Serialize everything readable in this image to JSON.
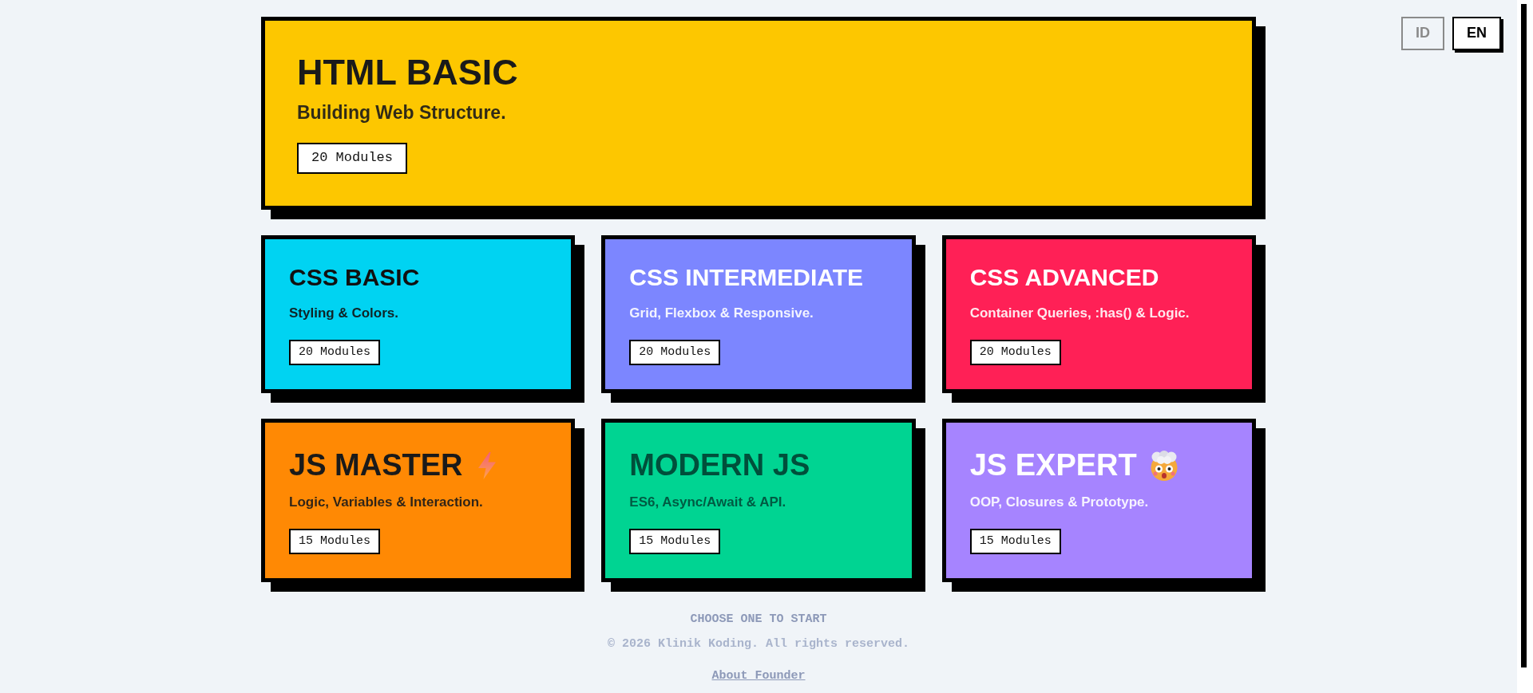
{
  "language_switch": [
    {
      "label": "ID",
      "selected": false
    },
    {
      "label": "EN",
      "selected": true
    }
  ],
  "course_rows": [
    {
      "courses": [
        {
          "kind": "plain",
          "title": {
            "text": "HTML BASIC",
            "color": "#1a1a1a"
          },
          "subtitle": "Building Web Structure.",
          "modules": "20 Modules",
          "color": "#fdc700"
        }
      ]
    },
    {
      "courses": [
        {
          "kind": "plain",
          "title": {
            "text": "CSS BASIC",
            "color": "#111111"
          },
          "subtitle": "Styling & Colors.",
          "modules": "20 Modules",
          "color": "#00d3f2"
        },
        {
          "kind": "plain",
          "title": {
            "text": "CSS INTERMEDIATE",
            "color": "#ffffff"
          },
          "subtitle": "Grid, Flexbox & Responsive.",
          "modules": "20 Modules",
          "color": "#7c86ff"
        },
        {
          "kind": "plain",
          "title": {
            "text": "CSS ADVANCED",
            "color": "#ffffff"
          },
          "subtitle": "Container Queries, :has() & Logic.",
          "modules": "20 Modules",
          "color": "#ff2056"
        }
      ]
    },
    {
      "courses": [
        {
          "kind": "bolt",
          "title": {
            "text": "JS MASTER",
            "color": "#1a1a1a"
          },
          "subtitle": "Logic, Variables & Interaction.",
          "modules": "15 Modules",
          "color": "#ff8904"
        },
        {
          "kind": "plain",
          "title": {
            "text": "MODERN JS",
            "color": "#004f3b"
          },
          "subtitle": "ES6, Async/Await & API.",
          "modules": "15 Modules",
          "color": "#00d492"
        },
        {
          "kind": "mindblown",
          "title": {
            "text": "JS EXPERT",
            "color": "#ffffff"
          },
          "subtitle": "OOP, Closures & Prototype.",
          "modules": "15 Modules",
          "color": "#a684ff"
        }
      ]
    }
  ],
  "footer": {
    "prompt": "CHOOSE ONE TO START",
    "copyright": "© 2026 Klinik Koding. All rights reserved.",
    "link": "About Founder"
  }
}
